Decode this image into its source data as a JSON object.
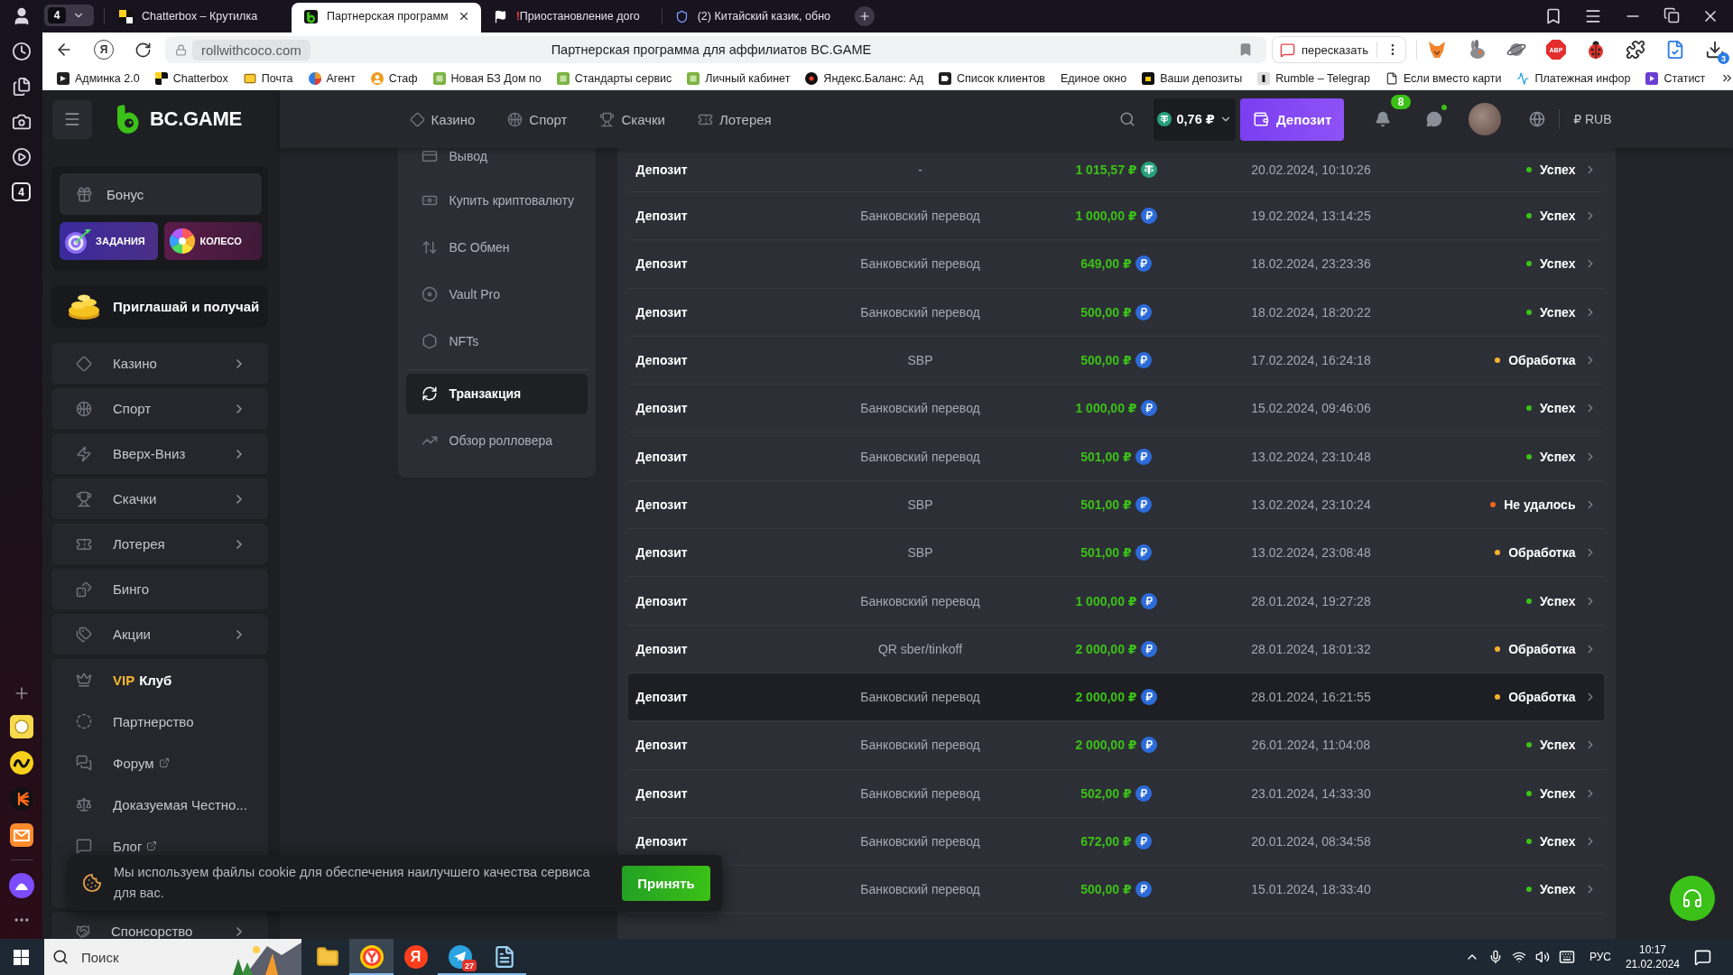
{
  "browser_sidebar": {
    "counter": "4"
  },
  "tab_strip": {
    "tab_count": "4",
    "tabs": [
      {
        "title": "Chatterbox – Крутилка",
        "selected": false
      },
      {
        "title": "Партнерская программ",
        "selected": true
      },
      {
        "alert": "!",
        "title": "Приостановление дого",
        "selected": false
      },
      {
        "title": "(2) Китайский казик, обно",
        "selected": false
      }
    ]
  },
  "address_bar": {
    "logo_glyph": "Я",
    "url": "rollwithcoco.com",
    "page_title": "Партнерская программа для аффилиатов BC.GAME",
    "retell_button": "пересказать",
    "adblock_label": "ABP",
    "downloads_badge": "3"
  },
  "bookmarks": [
    {
      "label": "Админка 2.0"
    },
    {
      "label": "Chatterbox"
    },
    {
      "label": "Почта"
    },
    {
      "label": "Агент"
    },
    {
      "label": "Стаф"
    },
    {
      "label": "Новая БЗ Дом по"
    },
    {
      "label": "Стандарты сервис"
    },
    {
      "label": "Личный кабинет"
    },
    {
      "label": "Яндекс.Баланс: Ад"
    },
    {
      "label": "Список клиентов"
    },
    {
      "label": "Единое окно"
    },
    {
      "label": "Ваши депозиты"
    },
    {
      "label": "Rumble – Telegrap"
    },
    {
      "label": "Если вместо карти"
    },
    {
      "label": "Платежная инфор"
    },
    {
      "label": "Статист"
    }
  ],
  "site": {
    "logo": "BC.GAME",
    "nav": [
      {
        "label": "Казино"
      },
      {
        "label": "Спорт"
      },
      {
        "label": "Скачки"
      },
      {
        "label": "Лотерея"
      }
    ],
    "balance": "0,76 ₽",
    "deposit_button": "Депозит",
    "notifications_badge": "8",
    "chat_online": true,
    "currency_button": "₽ RUB",
    "sidebar": {
      "bonus_button": "Бонус",
      "promos": [
        {
          "label": "ЗАДАНИЯ"
        },
        {
          "label": "КОЛЕСО"
        }
      ],
      "invite_banner": "Приглашай и получай",
      "menu": [
        {
          "label": "Казино",
          "expandable": true
        },
        {
          "label": "Спорт",
          "expandable": true
        },
        {
          "label": "Вверх-Вниз",
          "expandable": true
        },
        {
          "label": "Скачки",
          "expandable": true
        },
        {
          "label": "Лотерея",
          "expandable": true
        },
        {
          "label": "Бинго",
          "expandable": false
        },
        {
          "label": "Акции",
          "expandable": true
        }
      ],
      "links": [
        {
          "accent": "VIP",
          "label": "Клуб",
          "external": false
        },
        {
          "label": "Партнерство",
          "external": false
        },
        {
          "label": "Форум",
          "external": true
        },
        {
          "label": "Доказуемая Честно...",
          "external": false
        },
        {
          "label": "Блог",
          "external": true
        }
      ],
      "bottom_menu": [
        {
          "label": "Спонсорство",
          "expandable": true
        }
      ]
    },
    "wallet_menu": {
      "groups": [
        {
          "items": [
            {
              "label": "Вывод",
              "selected": false
            },
            {
              "label": "Купить криптовалюту",
              "selected": false
            },
            {
              "label": "BC Обмен",
              "selected": false
            },
            {
              "label": "Vault Pro",
              "selected": false
            },
            {
              "label": "NFTs",
              "selected": false
            }
          ]
        },
        {
          "items": [
            {
              "label": "Транзакция",
              "selected": true
            },
            {
              "label": "Обзор ролловера",
              "selected": false
            }
          ]
        }
      ]
    },
    "transactions": [
      {
        "type": "Депозит",
        "method": "-",
        "amount": "1 015,57 ₽",
        "kind": "tether",
        "date": "20.02.2024, 10:10:26",
        "status": "Успех",
        "color": "#3bc117",
        "hovered": false
      },
      {
        "type": "Депозит",
        "method": "Банковский перевод",
        "amount": "1 000,00 ₽",
        "kind": "ruble",
        "date": "19.02.2024, 13:14:25",
        "status": "Успех",
        "color": "#3bc117",
        "hovered": false
      },
      {
        "type": "Депозит",
        "method": "Банковский перевод",
        "amount": "649,00 ₽",
        "kind": "ruble",
        "date": "18.02.2024, 23:23:36",
        "status": "Успех",
        "color": "#3bc117",
        "hovered": false
      },
      {
        "type": "Депозит",
        "method": "Банковский перевод",
        "amount": "500,00 ₽",
        "kind": "ruble",
        "date": "18.02.2024, 18:20:22",
        "status": "Успех",
        "color": "#3bc117",
        "hovered": false
      },
      {
        "type": "Депозит",
        "method": "SBP",
        "amount": "500,00 ₽",
        "kind": "ruble",
        "date": "17.02.2024, 16:24:18",
        "status": "Обработка",
        "color": "#f5b130",
        "hovered": false
      },
      {
        "type": "Депозит",
        "method": "Банковский перевод",
        "amount": "1 000,00 ₽",
        "kind": "ruble",
        "date": "15.02.2024, 09:46:06",
        "status": "Успех",
        "color": "#3bc117",
        "hovered": false
      },
      {
        "type": "Депозит",
        "method": "Банковский перевод",
        "amount": "501,00 ₽",
        "kind": "ruble",
        "date": "13.02.2024, 23:10:48",
        "status": "Успех",
        "color": "#3bc117",
        "hovered": false
      },
      {
        "type": "Депозит",
        "method": "SBP",
        "amount": "501,00 ₽",
        "kind": "ruble",
        "date": "13.02.2024, 23:10:24",
        "status": "Не удалось",
        "color": "#f0651a",
        "hovered": false
      },
      {
        "type": "Депозит",
        "method": "SBP",
        "amount": "501,00 ₽",
        "kind": "ruble",
        "date": "13.02.2024, 23:08:48",
        "status": "Обработка",
        "color": "#f5b130",
        "hovered": false
      },
      {
        "type": "Депозит",
        "method": "Банковский перевод",
        "amount": "1 000,00 ₽",
        "kind": "ruble",
        "date": "28.01.2024, 19:27:28",
        "status": "Успех",
        "color": "#3bc117",
        "hovered": false
      },
      {
        "type": "Депозит",
        "method": "QR sber/tinkoff",
        "amount": "2 000,00 ₽",
        "kind": "ruble",
        "date": "28.01.2024, 18:01:32",
        "status": "Обработка",
        "color": "#f5b130",
        "hovered": false
      },
      {
        "type": "Депозит",
        "method": "Банковский перевод",
        "amount": "2 000,00 ₽",
        "kind": "ruble",
        "date": "28.01.2024, 16:21:55",
        "status": "Обработка",
        "color": "#f5b130",
        "hovered": true
      },
      {
        "type": "Депозит",
        "method": "Банковский перевод",
        "amount": "2 000,00 ₽",
        "kind": "ruble",
        "date": "26.01.2024, 11:04:08",
        "status": "Успех",
        "color": "#3bc117",
        "hovered": false
      },
      {
        "type": "Депозит",
        "method": "Банковский перевод",
        "amount": "502,00 ₽",
        "kind": "ruble",
        "date": "23.01.2024, 14:33:30",
        "status": "Успех",
        "color": "#3bc117",
        "hovered": false
      },
      {
        "type": "Депозит",
        "method": "Банковский перевод",
        "amount": "672,00 ₽",
        "kind": "ruble",
        "date": "20.01.2024, 08:34:58",
        "status": "Успех",
        "color": "#3bc117",
        "hovered": false
      },
      {
        "method": "Банковский перевод",
        "amount": "500,00 ₽",
        "kind": "ruble",
        "date": "15.01.2024, 18:33:40",
        "status": "Успех",
        "color": "#3bc117",
        "hovered": false
      }
    ],
    "cookie_banner": {
      "text": "Мы используем файлы cookie для обеспечения наилучшего качества сервиса\nдля вас.",
      "accept_button": "Принять"
    }
  },
  "taskbar": {
    "search_placeholder": "Поиск",
    "apps": [
      {
        "running": false,
        "active": false
      },
      {
        "running": true,
        "active": true
      },
      {
        "glyph": "Я",
        "running": false,
        "active": false
      },
      {
        "badge": "27",
        "running": true,
        "active": false
      },
      {
        "running": true,
        "active": false
      }
    ],
    "language": "РУС",
    "time": "10:17",
    "date": "21.02.2024"
  }
}
